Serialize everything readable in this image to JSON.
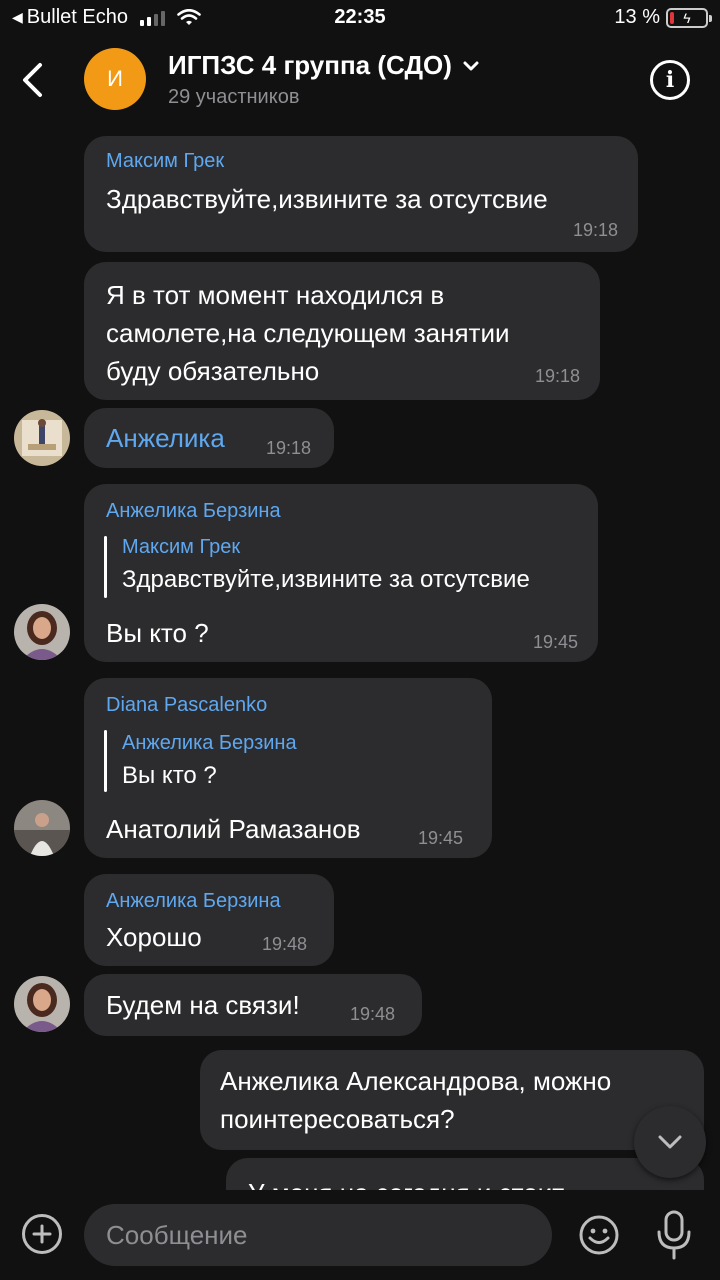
{
  "status_bar": {
    "back_app": "Bullet Echo",
    "time": "22:35",
    "battery": "13 %",
    "battery_level": 0.13
  },
  "header": {
    "avatar_letter": "И",
    "title": "ИГПЗС 4 группа (СДО)",
    "subtitle": "29 участников"
  },
  "messages": [
    {
      "sender": "Максим Грек",
      "text": "Здравствуйте,извините за отсутсвие",
      "time": "19:18"
    },
    {
      "text_lines": [
        "Я в тот момент находился в",
        "самолете,на следующем занятии",
        "буду обязательно"
      ],
      "time": "19:18"
    },
    {
      "text": "Анжелика",
      "time": "19:18"
    },
    {
      "sender": "Анжелика Берзина",
      "reply_name": "Максим Грек",
      "reply_text": "Здравствуйте,извините за отсутсвие",
      "text": "Вы кто ?",
      "time": "19:45"
    },
    {
      "sender": "Diana Pascalenko",
      "reply_name": "Анжелика Берзина",
      "reply_text": "Вы кто ?",
      "text": "Анатолий Рамазанов",
      "time": "19:45"
    },
    {
      "sender": "Анжелика Берзина",
      "text": "Хорошо",
      "time": "19:48"
    },
    {
      "text": "Будем на связи!",
      "time": "19:48"
    },
    {
      "text_lines": [
        "Анжелика Александрова, можно",
        "поинтересоваться?"
      ]
    },
    {
      "text": "У меня на сегодня и стоит"
    }
  ],
  "input": {
    "placeholder": "Сообщение"
  },
  "colors": {
    "background": "#111111",
    "bubble": "#2c2c2e",
    "accent": "#5fa8f0",
    "avatar": "#f29a16"
  }
}
